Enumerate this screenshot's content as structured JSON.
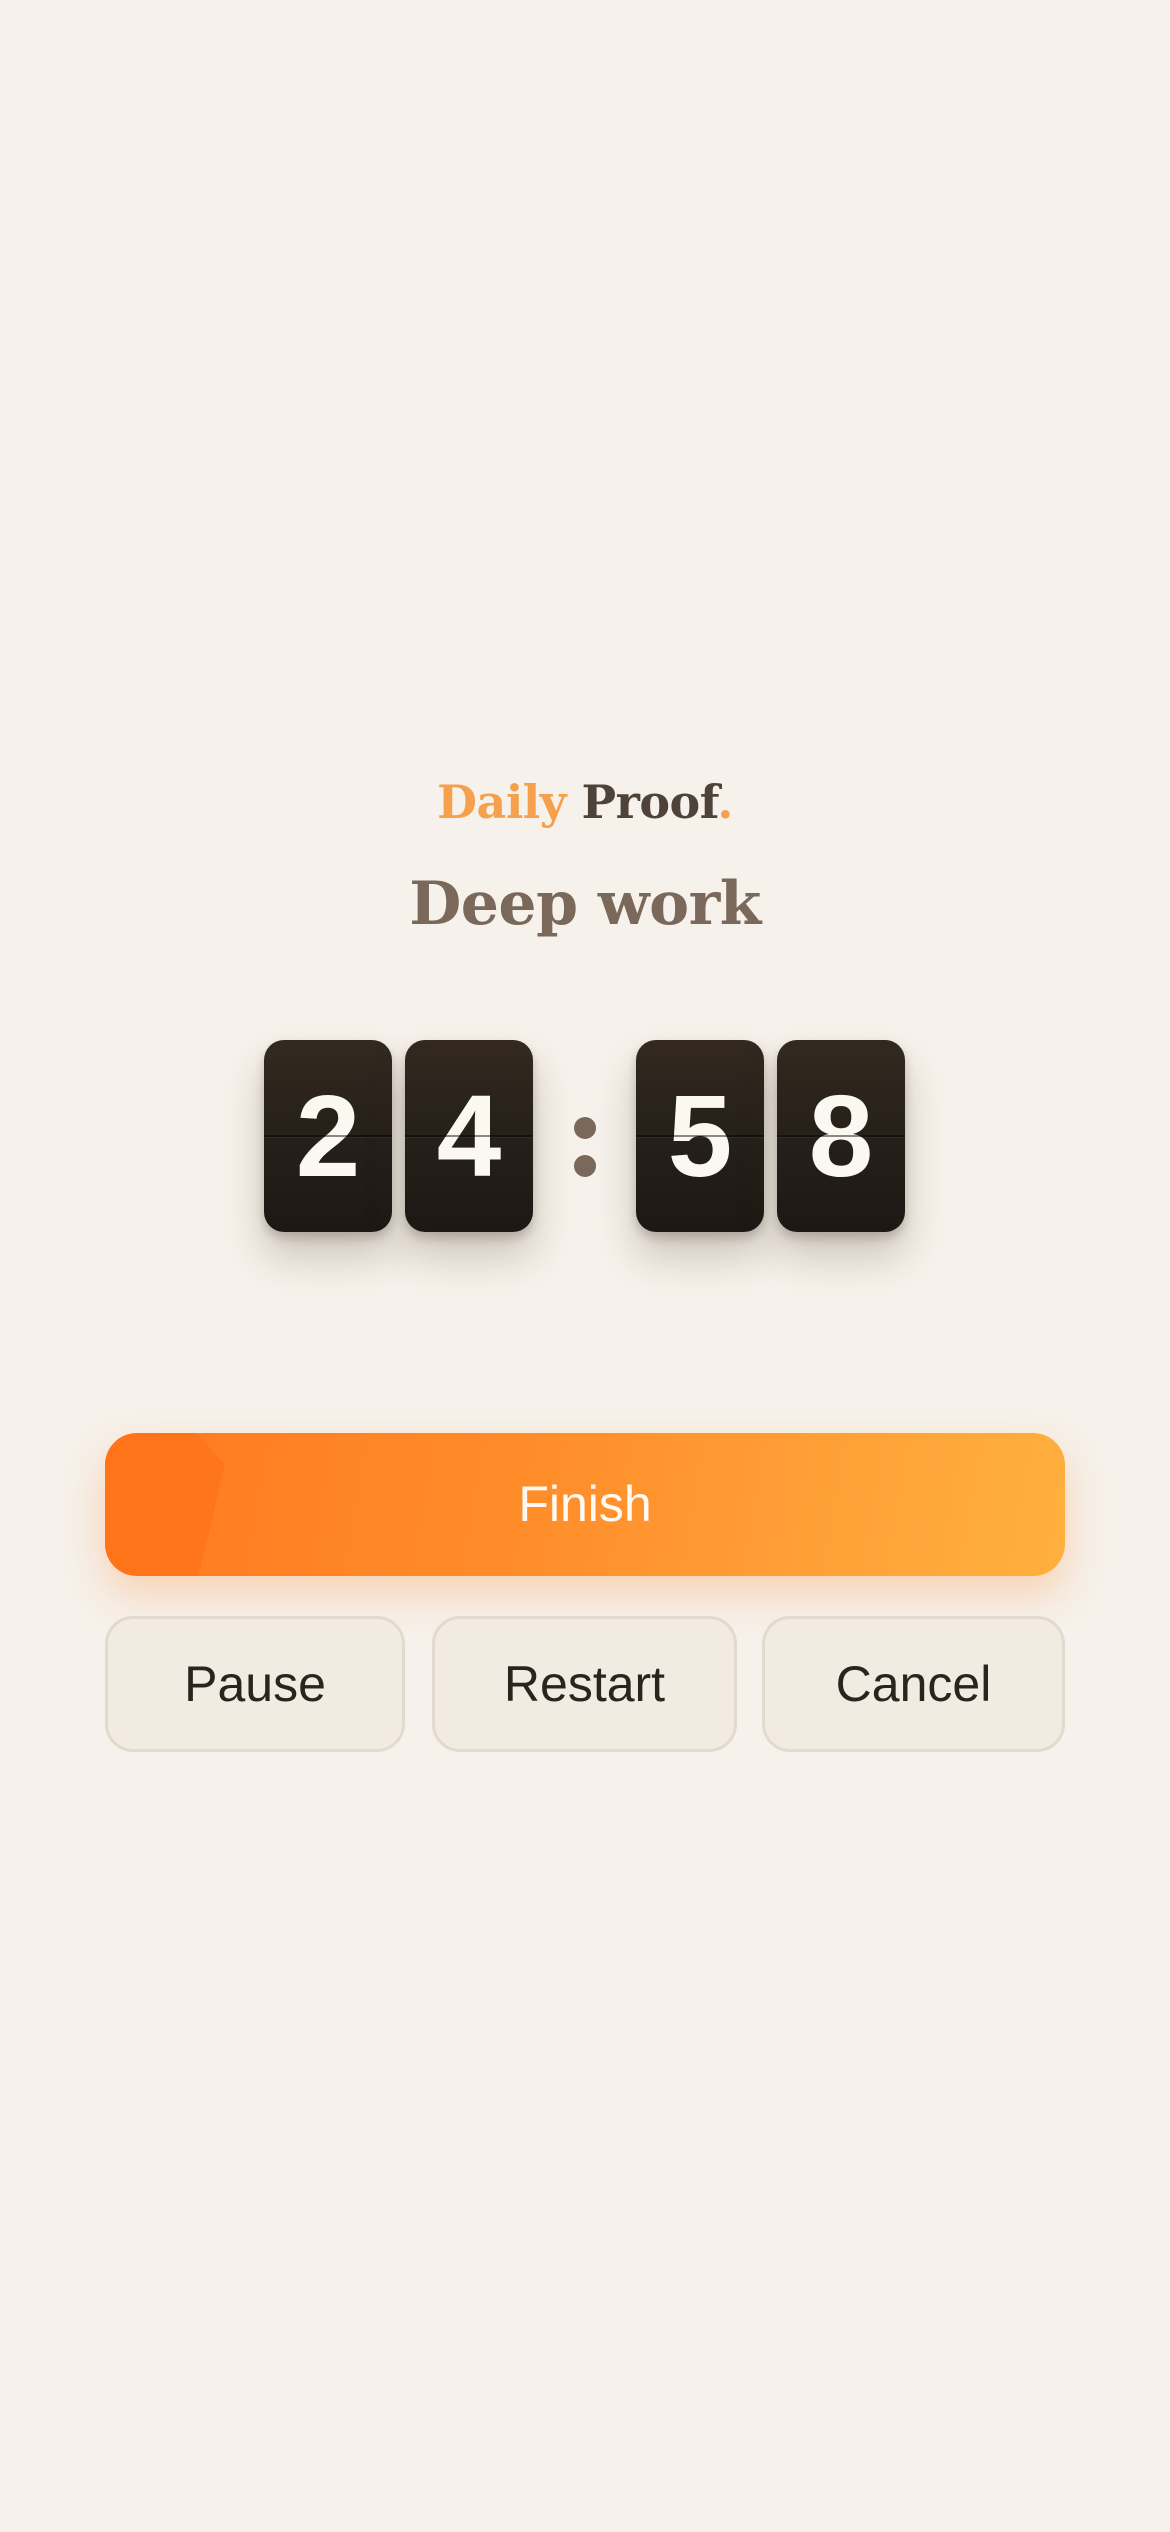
{
  "brand": {
    "word1": "Daily",
    "word2": "Proof",
    "dot": "."
  },
  "session": {
    "title": "Deep work"
  },
  "timer": {
    "minutes_tens": "2",
    "minutes_ones": "4",
    "separator": ":",
    "seconds_tens": "5",
    "seconds_ones": "8"
  },
  "actions": {
    "finish_label": "Finish",
    "pause_label": "Pause",
    "restart_label": "Restart",
    "cancel_label": "Cancel"
  },
  "colors": {
    "background": "#f6f1ea",
    "accent": "#ff8a28",
    "accent_light": "#ffb03e",
    "text_dark": "#2a241f",
    "text_muted": "#7a685a",
    "clock_face": "#26201a"
  }
}
